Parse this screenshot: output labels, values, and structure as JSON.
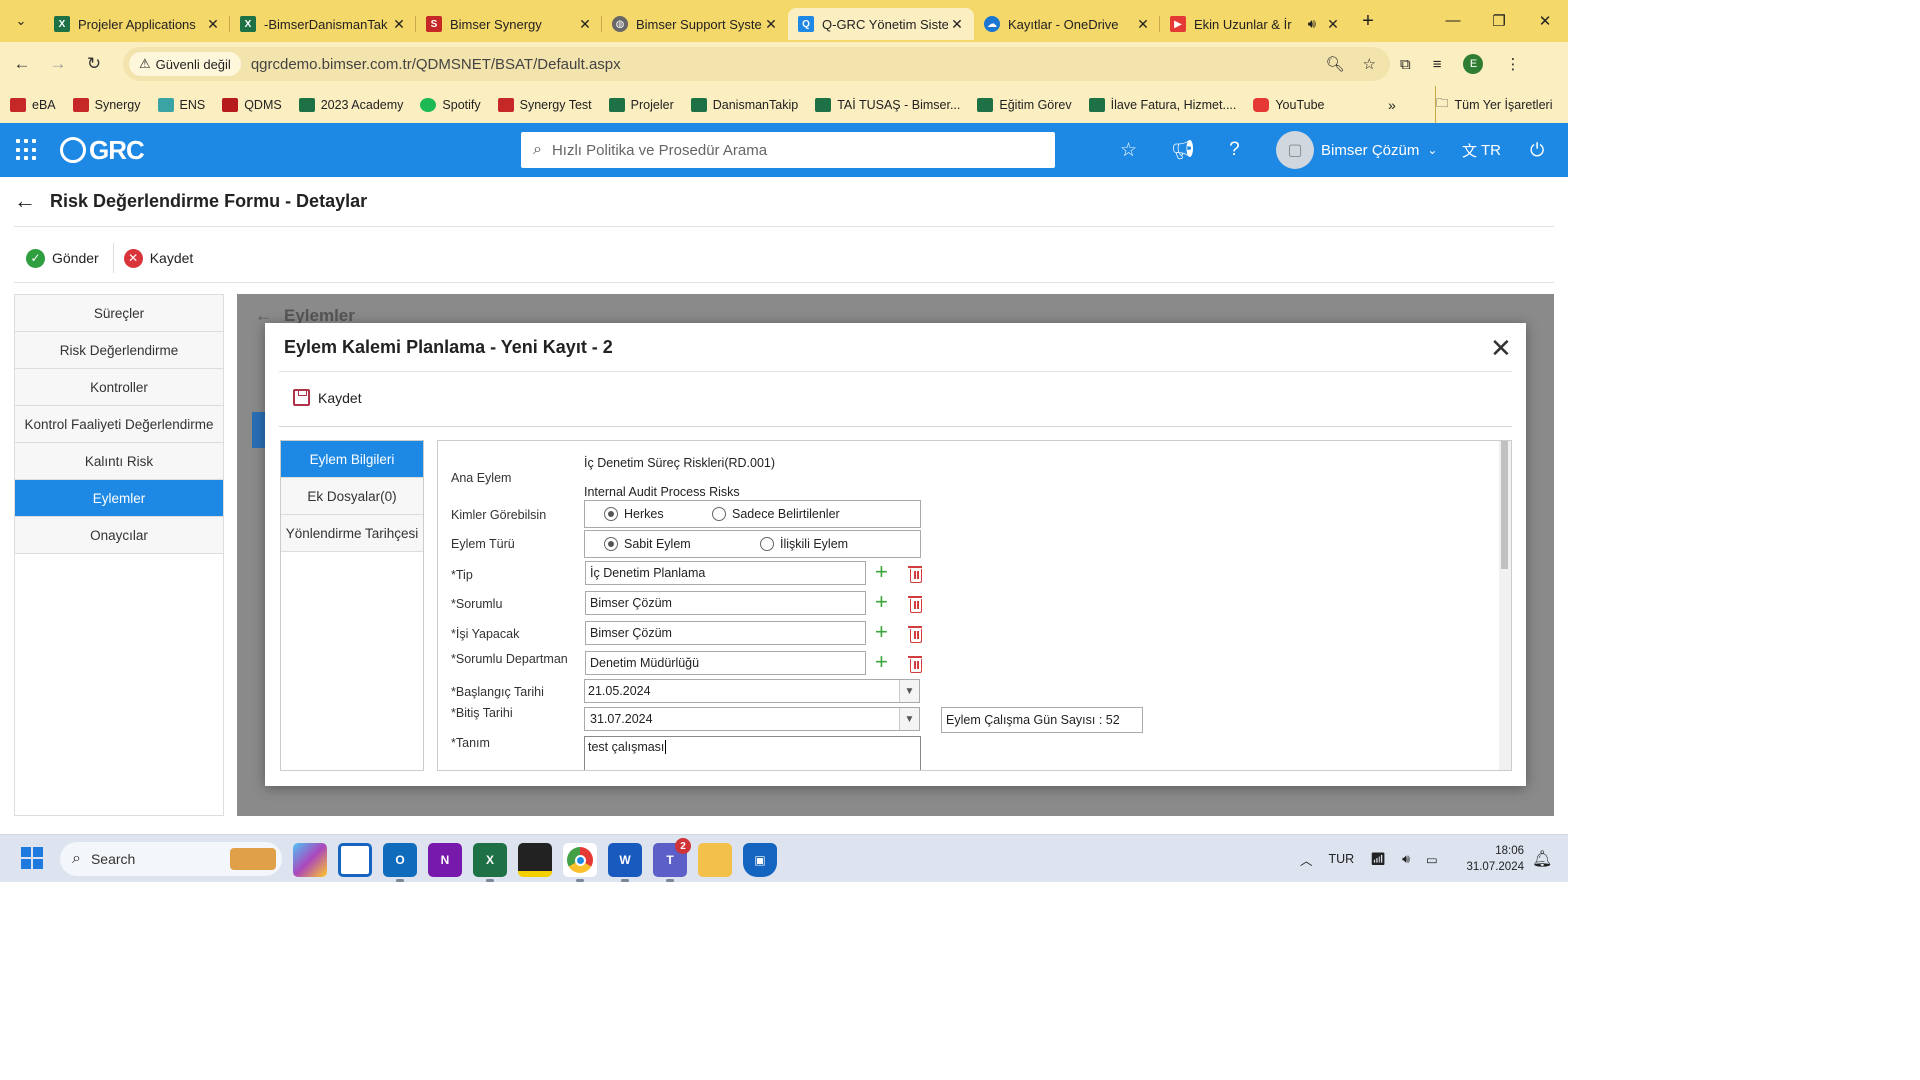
{
  "browser": {
    "tabs": [
      {
        "label": "Projeler Applications",
        "icon": "excel-icon",
        "color": "#1e7145"
      },
      {
        "label": "-BimserDanismanTak",
        "icon": "excel-icon",
        "color": "#1e7145"
      },
      {
        "label": "Bimser Synergy",
        "icon": "synergy-icon",
        "color": "#c62828"
      },
      {
        "label": "Bimser Support Syste",
        "icon": "globe-icon",
        "color": "#555555"
      },
      {
        "label": "Q-GRC Yönetim Siste",
        "icon": "qgrc-icon",
        "color": "#1e88e5",
        "active": true
      },
      {
        "label": "Kayıtlar - OneDrive",
        "icon": "onedrive-icon",
        "color": "#1976d2"
      },
      {
        "label": "Ekin Uzunlar & İr",
        "icon": "youtube-icon",
        "color": "#e53935"
      }
    ],
    "security_label": "Güvenli değil",
    "url": "qgrcdemo.bimser.com.tr/QDMSNET/BSAT/Default.aspx",
    "profile_initial": "E",
    "bookmarks": [
      {
        "label": "eBA",
        "color": "#c62828"
      },
      {
        "label": "Synergy",
        "color": "#c62828"
      },
      {
        "label": "ENS",
        "color": "#3aa3a3"
      },
      {
        "label": "QDMS",
        "color": "#b71c1c"
      },
      {
        "label": "2023 Academy",
        "color": "#1e7145"
      },
      {
        "label": "Spotify",
        "color": "#1db954"
      },
      {
        "label": "Synergy Test",
        "color": "#c62828"
      },
      {
        "label": "Projeler",
        "color": "#1e7145"
      },
      {
        "label": "DanismanTakip",
        "color": "#1e7145"
      },
      {
        "label": "TAİ TUSAŞ - Bimser...",
        "color": "#1e7145"
      },
      {
        "label": "Eğitim Görev",
        "color": "#1e7145"
      },
      {
        "label": "İlave Fatura, Hizmet....",
        "color": "#1e7145"
      },
      {
        "label": "YouTube",
        "color": "#e53935"
      }
    ],
    "all_bookmarks": "Tüm Yer İşaretleri"
  },
  "app": {
    "logo": "GRC",
    "search_placeholder": "Hızlı Politika ve Prosedür Arama",
    "user_name": "Bimser Çözüm",
    "language": "TR",
    "brand_color": "#1e88e5"
  },
  "page": {
    "title": "Risk Değerlendirme Formu - Detaylar",
    "send_label": "Gönder",
    "save_label": "Kaydet",
    "nav": [
      "Süreçler",
      "Risk Değerlendirme",
      "Kontroller",
      "Kontrol Faaliyeti Değerlendirme",
      "Kalıntı Risk",
      "Eylemler",
      "Onaycılar"
    ],
    "nav_active": "Eylemler",
    "behind_title": "Eylemler"
  },
  "modal": {
    "title": "Eylem Kalemi Planlama - Yeni Kayıt - 2",
    "save_label": "Kaydet",
    "tabs": [
      "Eylem Bilgileri",
      "Ek Dosyalar(0)",
      "Yönlendirme Tarihçesi"
    ],
    "form": {
      "ana_eylem_label": "Ana Eylem",
      "ana_eylem_value1": "İç Denetim Süreç Riskleri(RD.001)",
      "ana_eylem_value2": "Internal Audit Process Risks",
      "kimler_label": "Kimler Görebilsin",
      "kimler_opt1": "Herkes",
      "kimler_opt2": "Sadece Belirtilenler",
      "tur_label": "Eylem Türü",
      "tur_opt1": "Sabit Eylem",
      "tur_opt2": "İlişkili Eylem",
      "tip_label": "*Tip",
      "tip_value": "İç Denetim Planlama",
      "sorumlu_label": "*Sorumlu",
      "sorumlu_value": "Bimser Çözüm",
      "isi_label": "*İşi Yapacak",
      "isi_value": "Bimser Çözüm",
      "dept_label": "*Sorumlu Departman",
      "dept_value": "Denetim Müdürlüğü",
      "start_label": "*Başlangıç Tarihi",
      "start_value": "21.05.2024",
      "end_label": "*Bitiş Tarihi",
      "end_value": "31.07.2024",
      "workdays": "Eylem Çalışma Gün Sayısı : 52",
      "tanim_label": "*Tanım",
      "tanim_value": "test çalışması"
    }
  },
  "taskbar": {
    "search": "Search",
    "language": "TUR",
    "time": "18:06",
    "date": "31.07.2024",
    "teams_badge": "2"
  }
}
